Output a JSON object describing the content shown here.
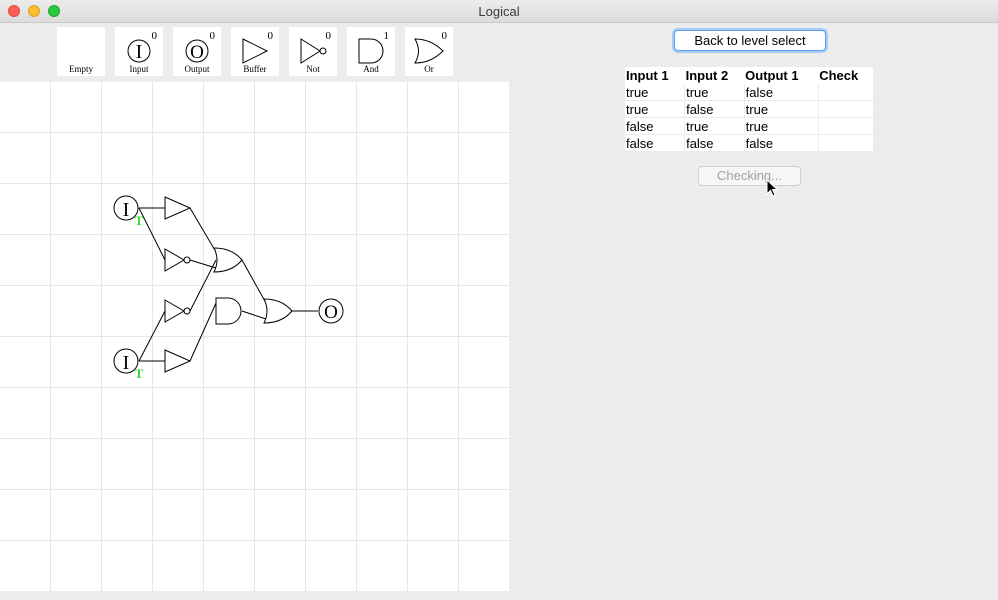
{
  "window": {
    "title": "Logical"
  },
  "palette": [
    {
      "label": "Empty",
      "count": "",
      "icon": "empty-icon"
    },
    {
      "label": "Input",
      "count": "0",
      "icon": "input-icon"
    },
    {
      "label": "Output",
      "count": "0",
      "icon": "output-icon"
    },
    {
      "label": "Buffer",
      "count": "0",
      "icon": "buffer-gate-icon"
    },
    {
      "label": "Not",
      "count": "0",
      "icon": "not-gate-icon"
    },
    {
      "label": "And",
      "count": "1",
      "icon": "and-gate-icon"
    },
    {
      "label": "Or",
      "count": "0",
      "icon": "or-gate-icon"
    }
  ],
  "board": {
    "input_symbol": "I",
    "output_symbol": "O",
    "input_values": [
      "T",
      "T"
    ]
  },
  "controls": {
    "back_label": "Back to level select",
    "check_label": "Checking..."
  },
  "truth_table": {
    "headers": [
      "Input 1",
      "Input 2",
      "Output 1",
      "Check"
    ],
    "rows": [
      [
        "true",
        "true",
        "false",
        ""
      ],
      [
        "true",
        "false",
        "true",
        ""
      ],
      [
        "false",
        "true",
        "true",
        ""
      ],
      [
        "false",
        "false",
        "false",
        ""
      ]
    ]
  },
  "colors": {
    "signal_true": "#33dd33",
    "focus": "#5b9ef1"
  }
}
